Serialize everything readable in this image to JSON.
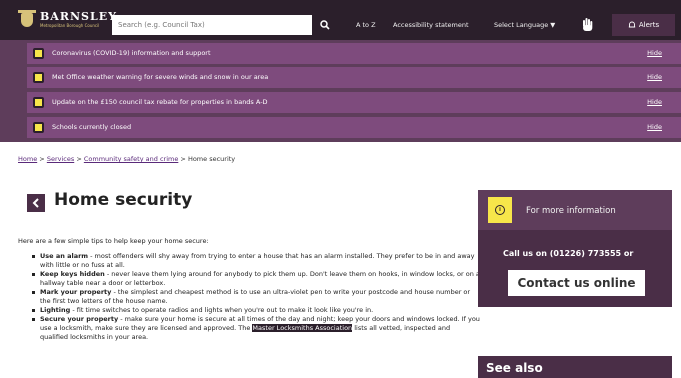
{
  "header": {
    "logo_name": "BARNSLEY",
    "logo_sub": "Metropolitan Borough Council",
    "search_placeholder": "Search (e.g. Council Tax)",
    "nav_atoz": "A to Z",
    "nav_accessibility": "Accessibility statement",
    "nav_language": "Select Language ▼",
    "alerts_label": "Alerts"
  },
  "alerts": [
    {
      "text": "Coronavirus (COVID-19) information and support",
      "hide": "Hide"
    },
    {
      "text": "Met Office weather warning for severe winds and snow in our area",
      "hide": "Hide"
    },
    {
      "text": "Update on the £150 council tax rebate for properties in bands A-D",
      "hide": "Hide"
    },
    {
      "text": "Schools currently closed",
      "hide": "Hide"
    }
  ],
  "breadcrumb": {
    "home": "Home",
    "services": "Services",
    "community": "Community safety and crime",
    "current": "Home security",
    "sep": ">"
  },
  "page": {
    "title": "Home security",
    "intro": "Here are a few simple tips to help keep your home secure:",
    "tips": [
      {
        "bold": "Use an alarm",
        "text": " - most offenders will shy away from trying to enter a house that has an alarm installed. They prefer to be in and away with little or no fuss at all."
      },
      {
        "bold": "Keep keys hidden",
        "text": " - never leave them lying around for anybody to pick them up. Don't leave them on hooks, in window locks, or on a hallway table near a door or letterbox."
      },
      {
        "bold": "Mark your property",
        "text": " - the simplest and cheapest method is to use an ultra-violet pen to write your postcode and house number or the first two letters of the house name."
      },
      {
        "bold": "Lighting",
        "text": " - fit time switches to operate radios and lights when you're out to make it look like you're in."
      },
      {
        "bold": "Secure your property",
        "text": " - make sure your home is secure at all times of the day and night; keep your doors and windows locked. If you use a locksmith, make sure they are licensed and approved. The ",
        "link": "Master Locksmiths Association",
        "after": " lists all vetted, inspected and qualified locksmiths in your area."
      }
    ]
  },
  "sidebar": {
    "more_info": "For more information",
    "call": "Call us on (01226) 773555 or",
    "contact": "Contact us online",
    "see_also": "See also"
  }
}
